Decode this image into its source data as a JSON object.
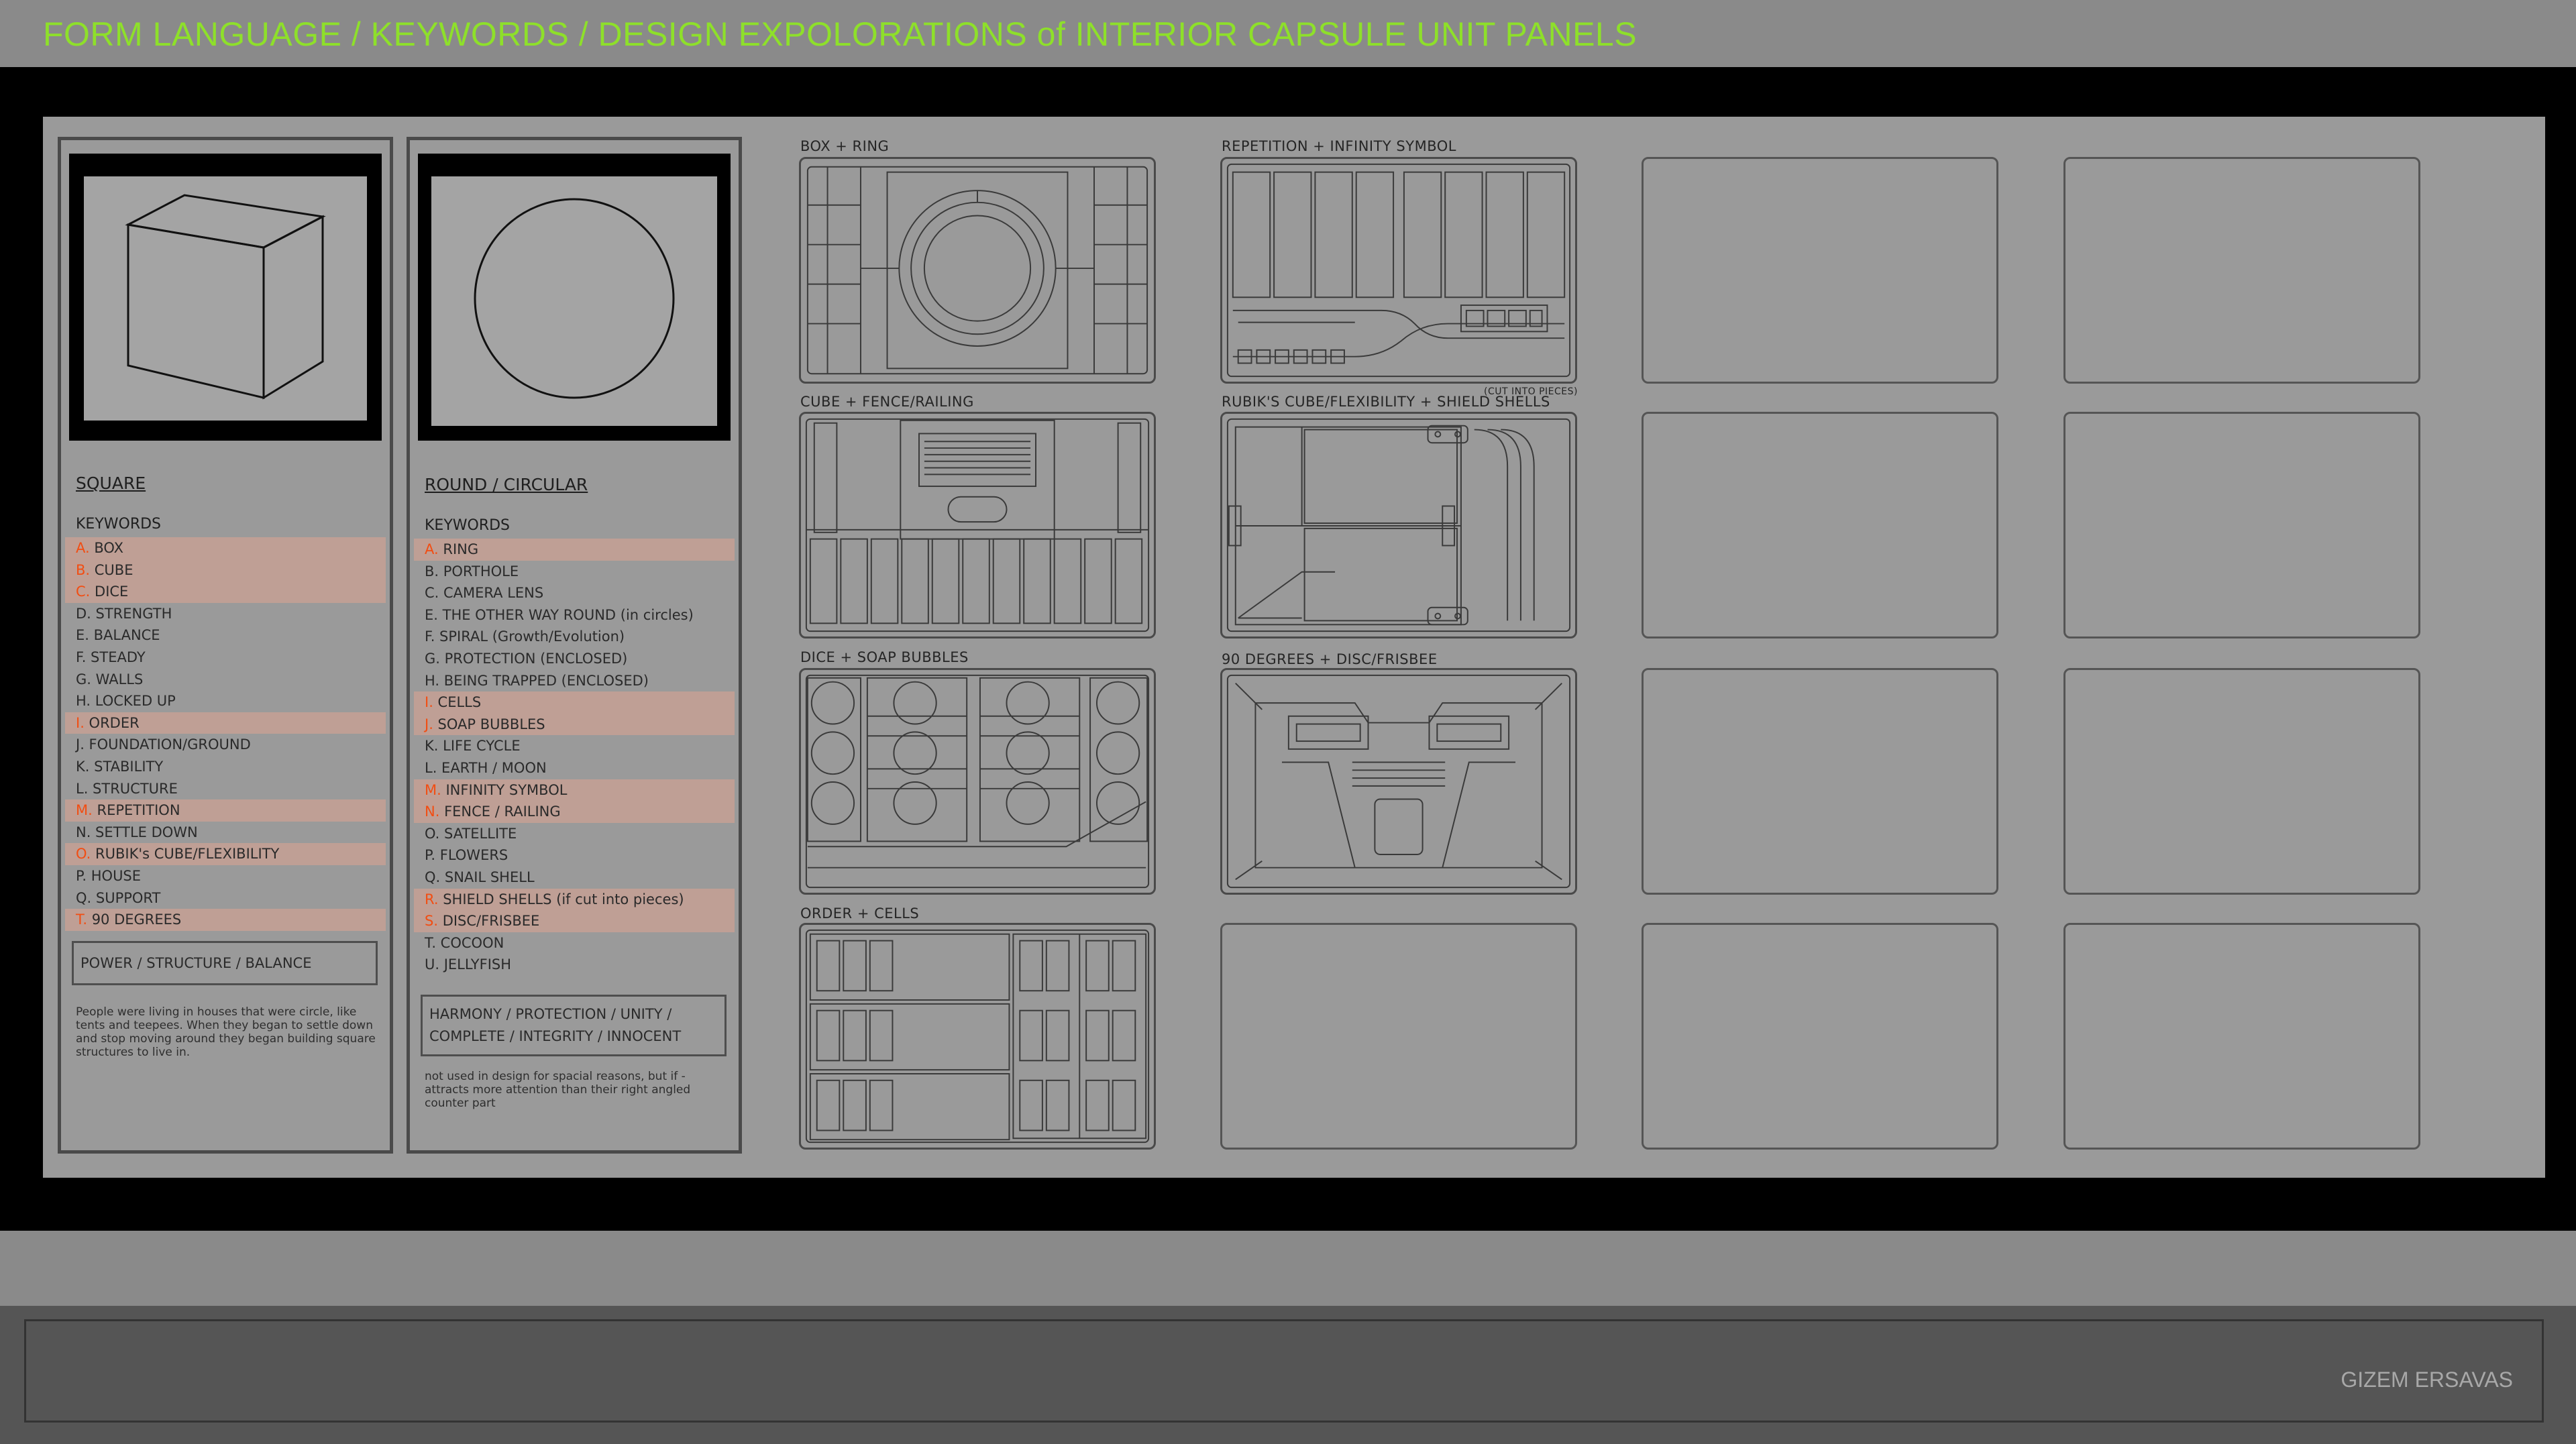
{
  "header": {
    "title": "FORM LANGUAGE / KEYWORDS / DESIGN EXPOLORATIONS of INTERIOR CAPSULE UNIT PANELS"
  },
  "footer": {
    "author": "GIZEM ERSAVAS"
  },
  "colors": {
    "title": "#8ee02a",
    "highlight": "#bf9f95",
    "highlight_letter": "#f24d12"
  },
  "square": {
    "heading": "SQUARE",
    "shape_icon": "cube-icon",
    "keywords_label": "KEYWORDS",
    "keywords": [
      {
        "text": "A. BOX",
        "highlighted": true
      },
      {
        "text": "B. CUBE",
        "highlighted": true
      },
      {
        "text": "C. DICE",
        "highlighted": true
      },
      {
        "text": "D. STRENGTH",
        "highlighted": false
      },
      {
        "text": "E. BALANCE",
        "highlighted": false
      },
      {
        "text": "F. STEADY",
        "highlighted": false
      },
      {
        "text": "G. WALLS",
        "highlighted": false
      },
      {
        "text": "H. LOCKED UP",
        "highlighted": false
      },
      {
        "text": "I. ORDER",
        "highlighted": true
      },
      {
        "text": "J. FOUNDATION/GROUND",
        "highlighted": false
      },
      {
        "text": "K. STABILITY",
        "highlighted": false
      },
      {
        "text": "L. STRUCTURE",
        "highlighted": false
      },
      {
        "text": "M. REPETITION",
        "highlighted": true
      },
      {
        "text": "N. SETTLE DOWN",
        "highlighted": false
      },
      {
        "text": "O. RUBIK's CUBE/FLEXIBILITY",
        "highlighted": true
      },
      {
        "text": "P. HOUSE",
        "highlighted": false
      },
      {
        "text": "Q. SUPPORT",
        "highlighted": false
      },
      {
        "text": "T. 90 DEGREES",
        "highlighted": true
      }
    ],
    "summary": "POWER / STRUCTURE / BALANCE",
    "note": "People were living in houses that were circle, like tents and teepees. When they began to settle down and stop moving around they began building square structures to live in."
  },
  "round": {
    "heading": "ROUND / CIRCULAR",
    "shape_icon": "circle-icon",
    "keywords_label": "KEYWORDS",
    "keywords": [
      {
        "text": "A. RING",
        "highlighted": true
      },
      {
        "text": "B. PORTHOLE",
        "highlighted": false
      },
      {
        "text": "C. CAMERA LENS",
        "highlighted": false
      },
      {
        "text": "E. THE OTHER WAY ROUND (in circles)",
        "highlighted": false
      },
      {
        "text": "F. SPIRAL (Growth/Evolution)",
        "highlighted": false
      },
      {
        "text": "G. PROTECTION (ENCLOSED)",
        "highlighted": false
      },
      {
        "text": "H. BEING TRAPPED (ENCLOSED)",
        "highlighted": false
      },
      {
        "text": "I. CELLS",
        "highlighted": true
      },
      {
        "text": "J. SOAP BUBBLES",
        "highlighted": true
      },
      {
        "text": "K. LIFE CYCLE",
        "highlighted": false
      },
      {
        "text": "L. EARTH / MOON",
        "highlighted": false
      },
      {
        "text": "M. INFINITY SYMBOL",
        "highlighted": true
      },
      {
        "text": "N. FENCE / RAILING",
        "highlighted": true
      },
      {
        "text": "O. SATELLITE",
        "highlighted": false
      },
      {
        "text": "P. FLOWERS",
        "highlighted": false
      },
      {
        "text": "Q. SNAIL SHELL",
        "highlighted": false
      },
      {
        "text": "R. SHIELD SHELLS (if cut into pieces)",
        "highlighted": true
      },
      {
        "text": "S. DISC/FRISBEE",
        "highlighted": true
      },
      {
        "text": "T. COCOON",
        "highlighted": false
      },
      {
        "text": "U. JELLYFISH",
        "highlighted": false
      }
    ],
    "summary": "HARMONY / PROTECTION / UNITY /\nCOMPLETE / INTEGRITY / INNOCENT",
    "note": "not used in design for spacial reasons, but if - attracts more attention than their right angled counter part"
  },
  "panels": [
    {
      "label": "BOX + RING",
      "icon": "box-ring-panel-icon"
    },
    {
      "label": "REPETITION + INFINITY SYMBOL",
      "icon": "repetition-infinity-panel-icon"
    },
    {
      "label": "CUBE + FENCE/RAILING",
      "icon": "cube-fence-panel-icon"
    },
    {
      "label": "RUBIK'S CUBE/FLEXIBILITY + SHIELD SHELLS",
      "sublabel": "(CUT INTO PIECES)",
      "icon": "rubiks-shield-panel-icon"
    },
    {
      "label": "DICE + SOAP BUBBLES",
      "icon": "dice-bubbles-panel-icon"
    },
    {
      "label": "90 DEGREES + DISC/FRISBEE",
      "icon": "degrees-disc-panel-icon"
    },
    {
      "label": "ORDER + CELLS",
      "icon": "order-cells-panel-icon"
    }
  ]
}
